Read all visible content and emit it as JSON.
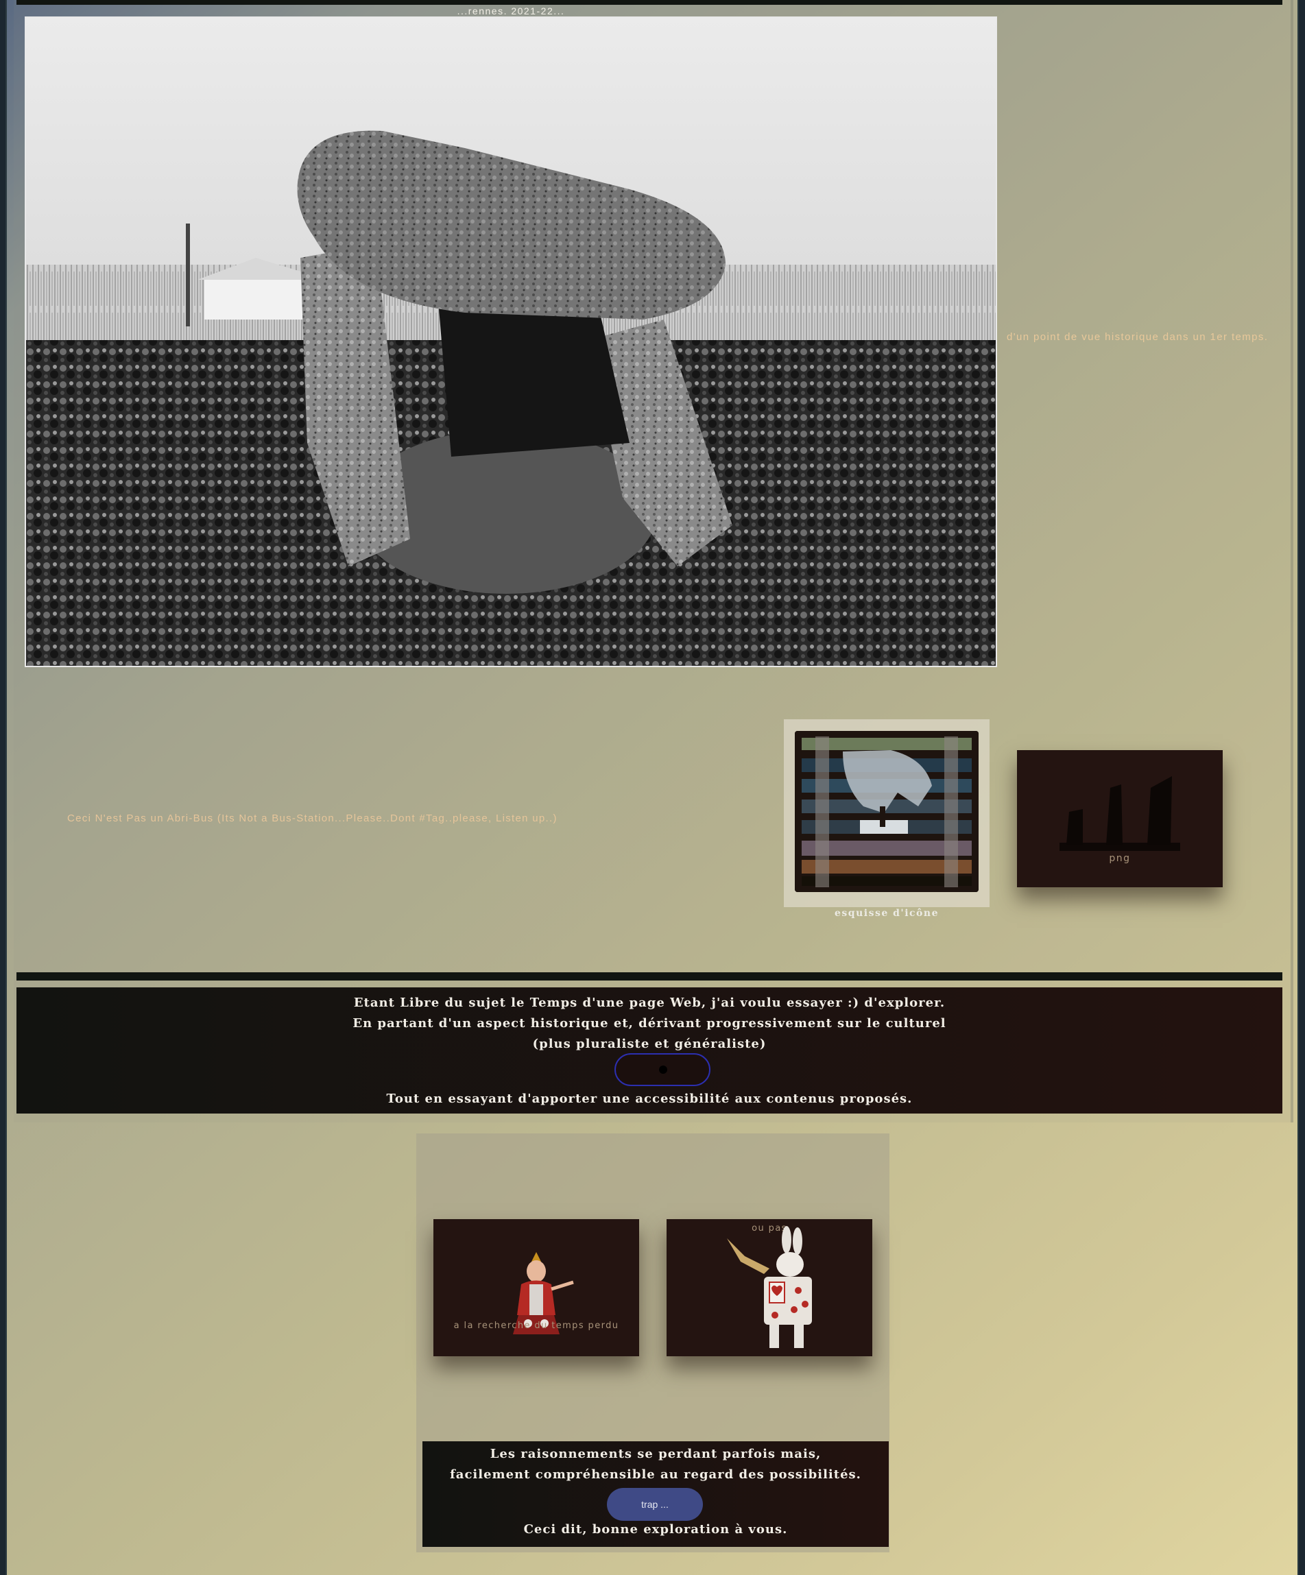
{
  "header": {
    "city_date": "...rennes. 2021-22..."
  },
  "hero": {
    "image_alt": "dolmen photograph",
    "side_caption": "d'un point de vue historique dans un 1er temps."
  },
  "gallery": {
    "bus_caption": "Ceci N'est Pas un Abri-Bus (Its Not a Bus-Station...Please..Dont #Tag..please, Listen up..)",
    "icon_card_label": "esquisse d'icône",
    "png_card_label": "png"
  },
  "intro": {
    "line1": "Etant Libre du sujet le Temps d'une page Web, j'ai voulu essayer :) d'explorer.",
    "line2": "En partant d'un aspect historique et, dérivant progressivement sur le culturel",
    "line3": "(plus pluraliste et généraliste)",
    "line4": "Tout en essayant d'apporter une accessibilité aux contenus proposés."
  },
  "cards": {
    "proust_label": "a la recherche du temps perdu",
    "ou_pas_label": "ou pas"
  },
  "outro": {
    "line1": "Les raisonnements se perdant parfois mais,",
    "line2": "facilement compréhensible au regard des possibilités.",
    "button_label": "trap ...",
    "line3": "Ceci dit, bonne exploration à vous."
  },
  "colors": {
    "accent_caption": "#e6c59a",
    "dark_card": "#241411",
    "button": "#3f4a86"
  }
}
